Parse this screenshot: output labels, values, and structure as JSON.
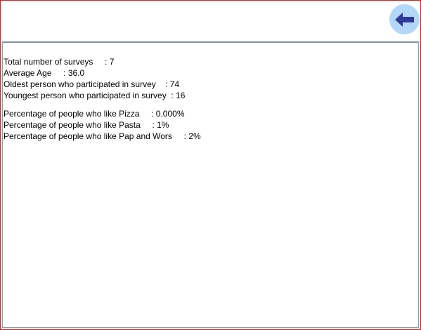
{
  "toolbar": {
    "back_icon": "arrow-left-icon",
    "back_color": "#2d3a97",
    "back_bg": "#b3d7f7"
  },
  "stats": {
    "total_surveys": "Total number of surveys     : 7",
    "average_age": "Average Age     : 36.0",
    "oldest": "Oldest person who participated in survey    : 74",
    "youngest": "Youngest person who participated in survey  : 16"
  },
  "food": {
    "pizza": "Percentage of people who like Pizza     : 0.000%",
    "pasta": "Percentage of people who like Pasta     : 1%",
    "pap_wors": "Percentage of people who like Pap and Wors     : 2%"
  },
  "colors": {
    "window_border": "#d11f1f",
    "panel_border": "#8a9bb0"
  }
}
